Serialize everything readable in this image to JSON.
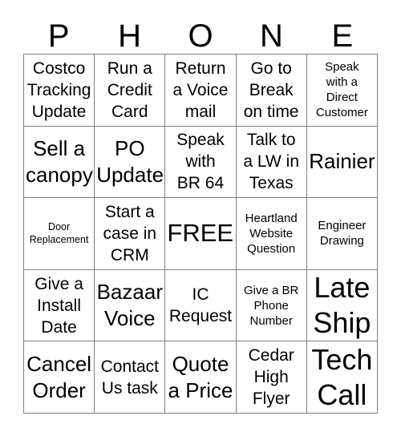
{
  "card": {
    "title_letters": [
      "P",
      "H",
      "O",
      "N",
      "E"
    ],
    "columns": 5,
    "rows": 5,
    "border_color": "#808080",
    "text_color": "#000000",
    "background_color": "#ffffff",
    "free_space": "FREE!",
    "cells": [
      {
        "text": "Costco\nTracking\nUpdate",
        "size": "md"
      },
      {
        "text": "Run a\nCredit\nCard",
        "size": "md"
      },
      {
        "text": "Return\na Voice\nmail",
        "size": "md"
      },
      {
        "text": "Go to\nBreak\non time",
        "size": "md"
      },
      {
        "text": "Speak\nwith a\nDirect\nCustomer",
        "size": "sm"
      },
      {
        "text": "Sell a\ncanopy",
        "size": "lg"
      },
      {
        "text": "PO\nUpdate",
        "size": "lg"
      },
      {
        "text": "Speak\nwith\nBR 64",
        "size": "md"
      },
      {
        "text": "Talk to\na LW in\nTexas",
        "size": "md"
      },
      {
        "text": "Rainier",
        "size": "lg"
      },
      {
        "text": "Door\nReplacement",
        "size": "xs"
      },
      {
        "text": "Start a\ncase in\nCRM",
        "size": "md"
      },
      {
        "text": "FREE!",
        "size": "xl"
      },
      {
        "text": "Heartland\nWebsite\nQuestion",
        "size": "sm"
      },
      {
        "text": "Engineer\nDrawing",
        "size": "sm"
      },
      {
        "text": "Give a\nInstall\nDate",
        "size": "md"
      },
      {
        "text": "Bazaar\nVoice",
        "size": "lg"
      },
      {
        "text": "IC\nRequest",
        "size": "md"
      },
      {
        "text": "Give a BR\nPhone\nNumber",
        "size": "sm"
      },
      {
        "text": "Late\nShip",
        "size": "xxl"
      },
      {
        "text": "Cancel\nOrder",
        "size": "lg"
      },
      {
        "text": "Contact\nUs task",
        "size": "md"
      },
      {
        "text": "Quote\na Price",
        "size": "lg"
      },
      {
        "text": "Cedar\nHigh\nFlyer",
        "size": "md"
      },
      {
        "text": "Tech\nCall",
        "size": "xxl"
      }
    ]
  }
}
